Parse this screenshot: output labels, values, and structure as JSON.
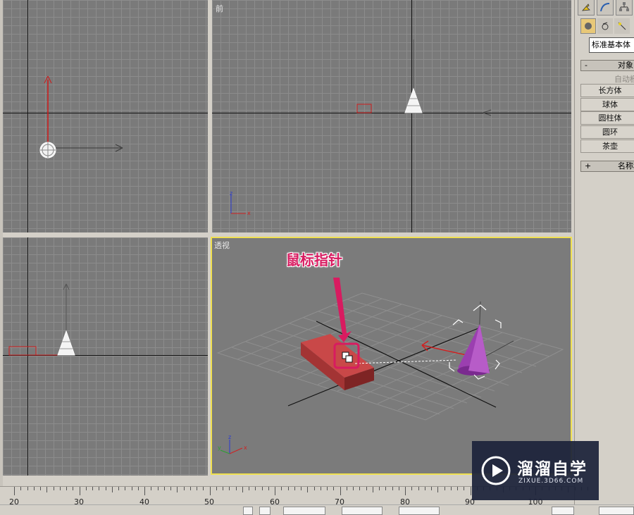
{
  "viewports": {
    "top_left": {
      "label": ""
    },
    "top_right": {
      "label": "前"
    },
    "bottom_left": {
      "label": ""
    },
    "perspective": {
      "label": "透视"
    }
  },
  "annotation": {
    "callout_text": "鼠标指针",
    "color": "#d81b60"
  },
  "command_panel": {
    "toolbar_icons": [
      "create-icon",
      "modify-icon",
      "hierarchy-icon"
    ],
    "subtabs_icons": [
      "geometry-icon",
      "shapes-icon",
      "lights-icon"
    ],
    "category_dropdown": "标准基本体",
    "object_type_rollout": {
      "sign": "-",
      "title": "对象"
    },
    "autogrid_label": "自动栅",
    "buttons": [
      "长方体",
      "球体",
      "圆柱体",
      "圆环",
      "茶壶"
    ],
    "name_color_rollout": {
      "sign": "+",
      "title": "名称和"
    }
  },
  "time_ruler": {
    "labels": [
      "20",
      "30",
      "40",
      "50",
      "60",
      "70",
      "80",
      "90",
      "100"
    ]
  },
  "watermark": {
    "main": "溜溜自学",
    "sub": "ZIXUE.3D66.COM"
  },
  "colors": {
    "active_viewport_border": "#f0e050",
    "box_object": "#b83a3a",
    "cone_object": "#9b3fb0"
  }
}
